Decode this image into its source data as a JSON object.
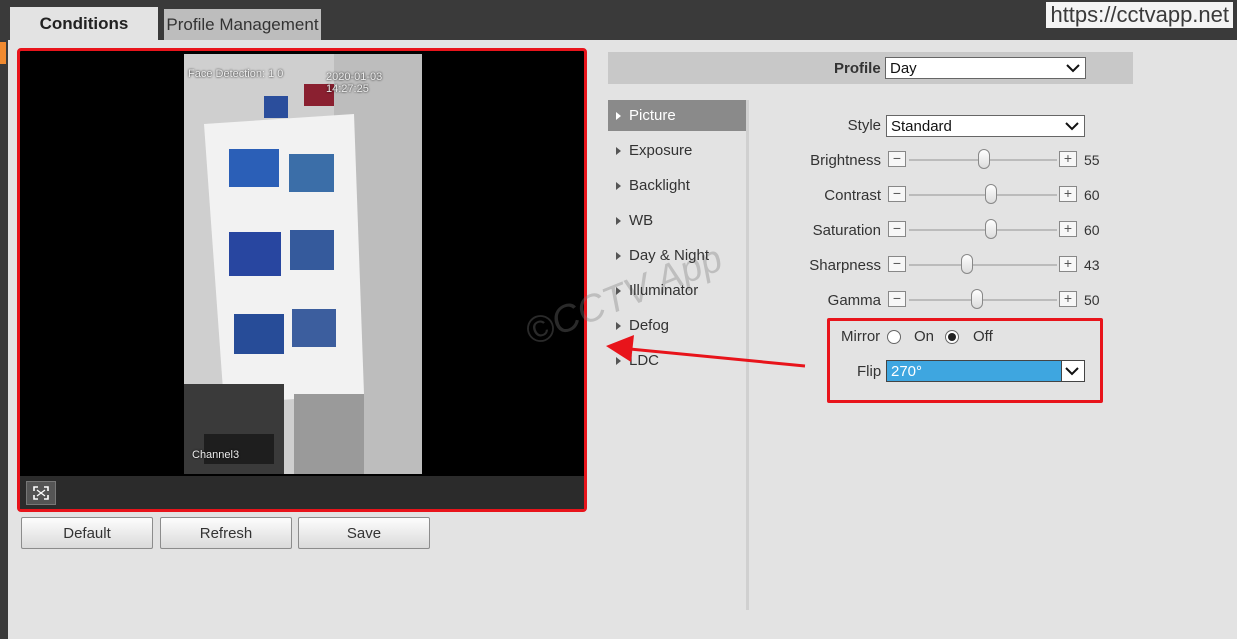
{
  "tabs": [
    {
      "label": "Conditions",
      "active": true
    },
    {
      "label": "Profile Management",
      "active": false
    }
  ],
  "watermark_url": "https://cctvapp.net",
  "video": {
    "overlay_title": "Face Detection: 1 0",
    "timestamp": "2020-01-03 14:27:25",
    "channel": "Channel3",
    "toolbar_icon": "fullscreen-icon"
  },
  "buttons": {
    "default": "Default",
    "refresh": "Refresh",
    "save": "Save"
  },
  "profile": {
    "label": "Profile",
    "value": "Day"
  },
  "nav": [
    {
      "label": "Picture",
      "active": true
    },
    {
      "label": "Exposure"
    },
    {
      "label": "Backlight"
    },
    {
      "label": "WB"
    },
    {
      "label": "Day & Night"
    },
    {
      "label": "Illuminator"
    },
    {
      "label": "Defog"
    },
    {
      "label": "LDC"
    }
  ],
  "style": {
    "label": "Style",
    "value": "Standard"
  },
  "sliders": [
    {
      "label": "Brightness",
      "value": "55",
      "level": 55
    },
    {
      "label": "Contrast",
      "value": "60",
      "level": 60
    },
    {
      "label": "Saturation",
      "value": "60",
      "level": 60
    },
    {
      "label": "Sharpness",
      "value": "43",
      "level": 43
    },
    {
      "label": "Gamma",
      "value": "50",
      "level": 50
    }
  ],
  "mirror": {
    "label": "Mirror",
    "on_label": "On",
    "off_label": "Off",
    "selected": "Off"
  },
  "flip": {
    "label": "Flip",
    "value": "270°"
  },
  "colors": {
    "accent_red": "#e8141b",
    "select_blue": "#3ea6e0",
    "active_nav": "#8a8a8a"
  }
}
